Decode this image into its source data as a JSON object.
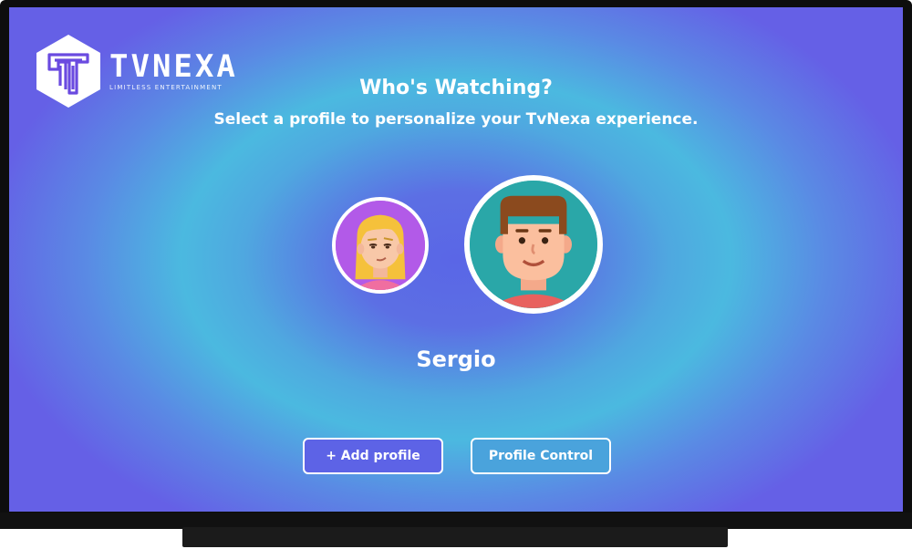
{
  "brand": {
    "name": "TVNEXA",
    "tagline": "LIMITLESS ENTERTAINMENT"
  },
  "header": {
    "title": "Who's Watching?",
    "subtitle": "Select a profile to personalize your TvNexa experience."
  },
  "profiles": {
    "selected_name": "Sergio",
    "items": [
      {
        "avatar": "woman-avatar-icon",
        "bg": "#b25ae8"
      },
      {
        "avatar": "man-avatar-icon",
        "bg": "#2aa7a8",
        "selected": true
      }
    ]
  },
  "actions": {
    "add_label": "+ Add profile",
    "control_label": "Profile Control"
  },
  "colors": {
    "accent": "#5d63e6",
    "secondary": "#4aa3dc",
    "background_center": "#5a66e6",
    "background_ring": "#4bb9e0"
  }
}
